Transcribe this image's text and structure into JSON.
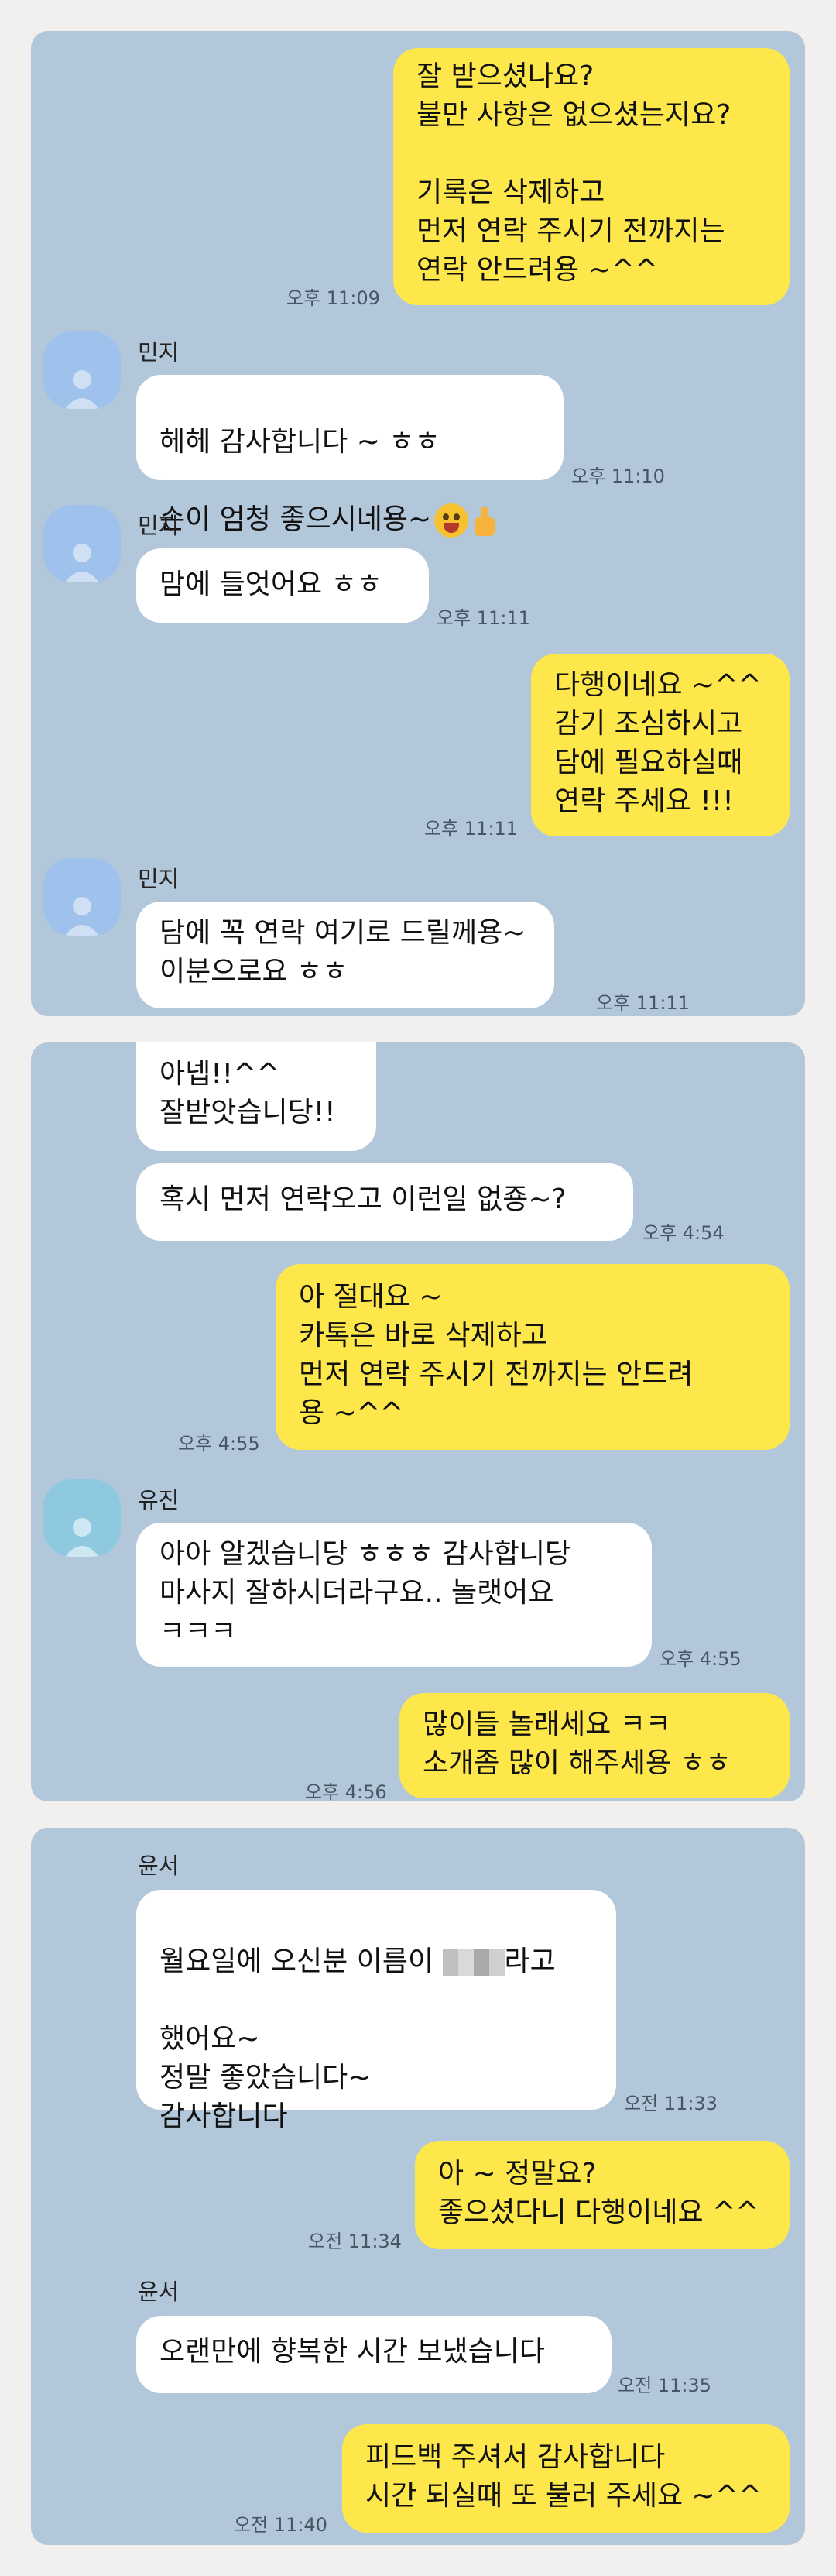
{
  "panel1": {
    "m1": {
      "text": "잘 받으셨나요?\n불만 사항은 없으셨는지요?\n\n기록은 삭제하고\n먼저 연락 주시기 전까지는\n연락 안드려용 ~^^",
      "time": "오후 11:09"
    },
    "m2": {
      "name": "민지",
      "line1": "헤헤 감사합니다 ~ ㅎㅎ",
      "line2": "손이 엄청 좋으시네용~",
      "time": "오후 11:10"
    },
    "m3": {
      "name": "민지",
      "text": "맘에 들엇어요 ㅎㅎ",
      "time": "오후 11:11"
    },
    "m4": {
      "text": "다행이네요 ~^^\n감기 조심하시고\n담에 필요하실때\n연락 주세요 !!!",
      "time": "오후 11:11"
    },
    "m5": {
      "name": "민지",
      "text": "담에 꼭 연락 여기로 드릴께용~\n이분으로요 ㅎㅎ",
      "time": "오후 11:11"
    }
  },
  "panel2": {
    "m1": {
      "text": "아넵!!^^\n잘받앗습니당!!"
    },
    "m2": {
      "text": "혹시 먼저 연락오고 이런일 없죵~?",
      "time": "오후 4:54"
    },
    "m3": {
      "text": "아 절대요 ~\n카톡은 바로 삭제하고\n먼저 연락 주시기 전까지는 안드려\n용 ~^^",
      "time": "오후 4:55"
    },
    "m4": {
      "name": "유진",
      "text": "아아 알겠습니당 ㅎㅎㅎ 감사합니당\n마사지 잘하시더라구요.. 놀랫어요\nㅋㅋㅋ",
      "time": "오후 4:55"
    },
    "m5": {
      "text": "많이들 놀래세요 ㅋㅋ\n소개좀 많이 해주세용 ㅎㅎ",
      "time": "오후 4:56"
    }
  },
  "panel3": {
    "m1": {
      "name": "윤서",
      "line1a": "월요일에 오신분 이름이 ",
      "line1b": "라고",
      "rest": "했어요~\n정말 좋았습니다~\n감사합니다",
      "time": "오전 11:33"
    },
    "m2": {
      "text": "아 ~ 정말요?\n좋으셨다니 다행이네요 ^^",
      "time": "오전 11:34"
    },
    "m3": {
      "name": "윤서",
      "text": "오랜만에 향복한 시간 보냈습니다",
      "time": "오전 11:35"
    },
    "m4": {
      "text": "피드백 주셔서 감사합니다\n시간 되실때 또 불러 주세요 ~^^",
      "time": "오전 11:40"
    }
  },
  "colors": {
    "my_bubble": "#fee74b",
    "other_bubble": "#ffffff",
    "chat_bg": "#b2c7da",
    "page_bg": "#f2f0ee"
  }
}
